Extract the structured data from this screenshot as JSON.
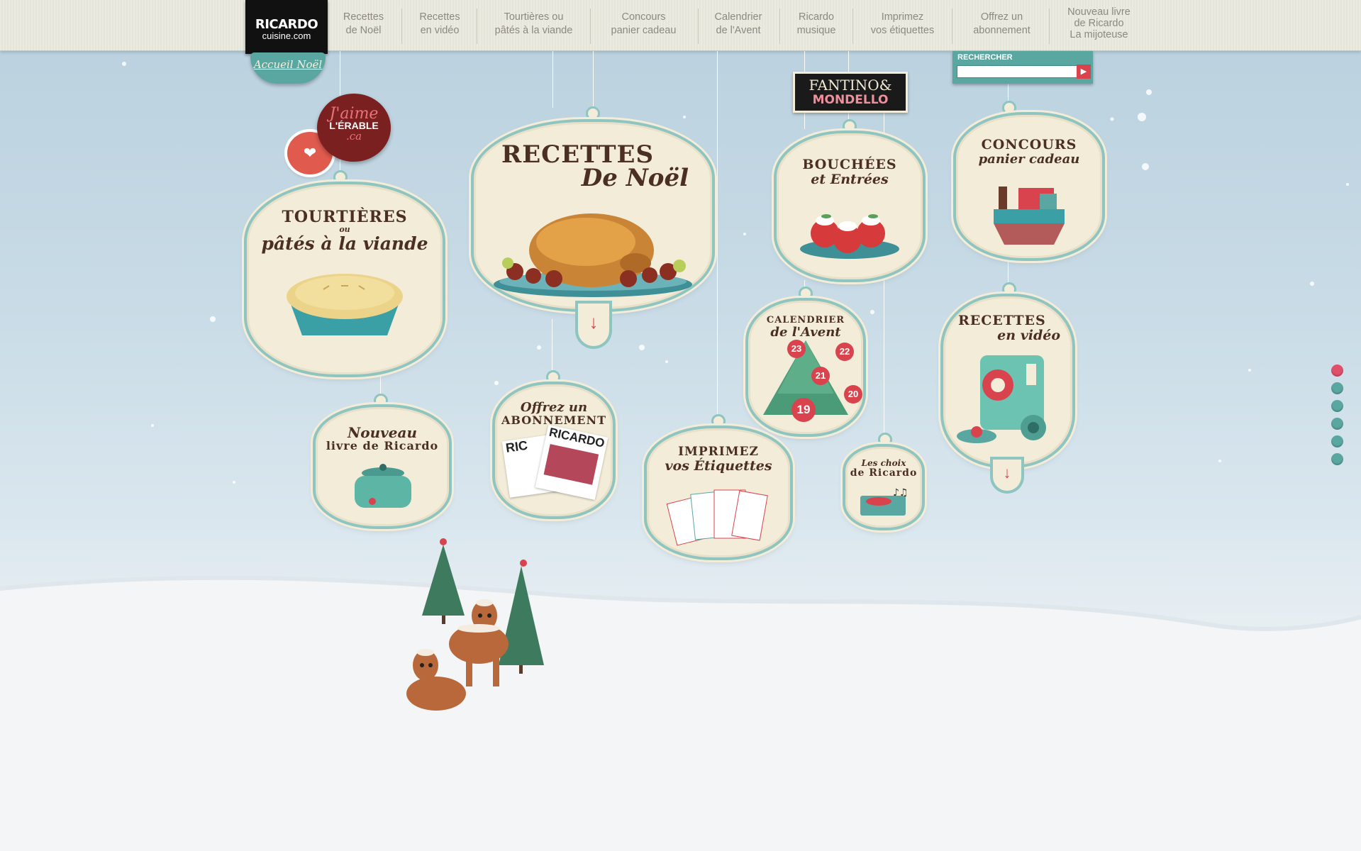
{
  "logo": {
    "line1": "RICARDO",
    "line2": "cuisine.com"
  },
  "nav": [
    {
      "label": "Recettes\nde Noël"
    },
    {
      "label": "Recettes\nen vidéo"
    },
    {
      "label": "Tourtières ou\npâtés à la viande"
    },
    {
      "label": "Concours\npanier cadeau"
    },
    {
      "label": "Calendrier\nde l'Avent"
    },
    {
      "label": "Ricardo\nmusique"
    },
    {
      "label": "Imprimez\nvos étiquettes"
    },
    {
      "label": "Offrez un\nabonnement"
    },
    {
      "label": "Nouveau livre\nde Ricardo\nLa mijoteuse"
    }
  ],
  "accueil": {
    "label": "Accueil Noël"
  },
  "erable": {
    "l1": "J'aime",
    "l2": "L'ÉRABLE",
    "l3": ".ca"
  },
  "fantino": {
    "l1": "FANTINO&",
    "l2": "MONDELLO"
  },
  "search": {
    "label": "RECHERCHER",
    "placeholder": "",
    "value": ""
  },
  "tags": {
    "noel": {
      "title": "RECETTES",
      "sub": "De Noël"
    },
    "tourtieres": {
      "title": "TOURTIÈRES",
      "ou": "ou",
      "sub": "pâtés à la viande"
    },
    "bouchees": {
      "title": "BOUCHÉES",
      "sub": "et Entrées"
    },
    "concours": {
      "title": "CONCOURS",
      "sub": "panier cadeau"
    },
    "calendrier": {
      "title": "CALENDRIER",
      "sub": "de l'Avent",
      "days": [
        "23",
        "22",
        "21",
        "20",
        "19"
      ]
    },
    "video": {
      "title": "RECETTES",
      "sub": "en vidéo"
    },
    "livre": {
      "title": "Nouveau",
      "sub": "livre de Ricardo"
    },
    "abonnement": {
      "title": "Offrez un",
      "sub": "ABONNEMENT",
      "mag": "RICARDO",
      "mag2": "RIC"
    },
    "etiquettes": {
      "title": "IMPRIMEZ",
      "sub": "vos Étiquettes"
    },
    "musique": {
      "title": "Les choix",
      "sub": "de Ricardo"
    }
  },
  "colors": {
    "teal": "#5aa7a2",
    "red": "#d9434d",
    "cream": "#f3ecd8",
    "brown": "#4a2f22"
  },
  "dots": [
    {
      "active": true
    },
    {
      "active": false
    },
    {
      "active": false
    },
    {
      "active": false
    },
    {
      "active": false
    },
    {
      "active": false
    }
  ]
}
